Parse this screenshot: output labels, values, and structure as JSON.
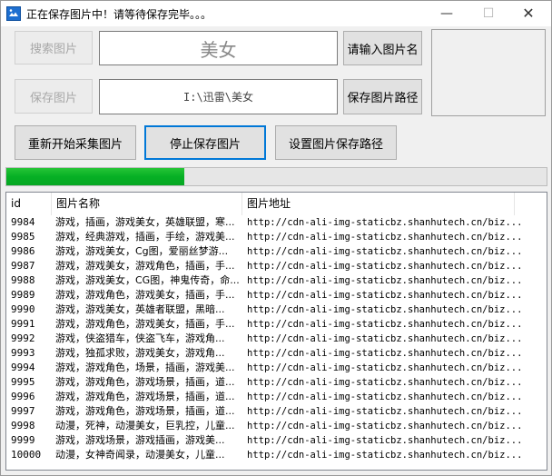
{
  "window": {
    "title": "正在保存图片中！请等待保存完毕。。。",
    "minimize": "—",
    "maximize": "☐",
    "close": "✕"
  },
  "controls": {
    "search_button": "搜索图片",
    "keyword_value": "美女",
    "enter_name_button": "请输入图片名",
    "save_button": "保存图片",
    "path_value": "I:\\迅雷\\美女",
    "save_path_button": "保存图片路径",
    "restart_button": "重新开始采集图片",
    "stop_button": "停止保存图片",
    "set_path_button": "设置图片保存路径"
  },
  "progress": {
    "percent": 33,
    "color": "#06b025"
  },
  "list": {
    "columns": [
      "id",
      "图片名称",
      "图片地址"
    ],
    "rows": [
      {
        "id": "9984",
        "name": "游戏，插画，游戏美女，英雄联盟，寒...",
        "url": "http://cdn-ali-img-staticbz.shanhutech.cn/biz..."
      },
      {
        "id": "9985",
        "name": "游戏，经典游戏，插画，手绘，游戏美...",
        "url": "http://cdn-ali-img-staticbz.shanhutech.cn/biz..."
      },
      {
        "id": "9986",
        "name": "游戏，游戏美女，Cg图，爱丽丝梦游...",
        "url": "http://cdn-ali-img-staticbz.shanhutech.cn/biz..."
      },
      {
        "id": "9987",
        "name": "游戏，游戏美女，游戏角色，插画，手...",
        "url": "http://cdn-ali-img-staticbz.shanhutech.cn/biz..."
      },
      {
        "id": "9988",
        "name": "游戏，游戏美女，CG图，神鬼传奇，命...",
        "url": "http://cdn-ali-img-staticbz.shanhutech.cn/biz..."
      },
      {
        "id": "9989",
        "name": "游戏，游戏角色，游戏美女，插画，手...",
        "url": "http://cdn-ali-img-staticbz.shanhutech.cn/biz..."
      },
      {
        "id": "9990",
        "name": "游戏，游戏美女，英雄者联盟，黑暗...",
        "url": "http://cdn-ali-img-staticbz.shanhutech.cn/biz..."
      },
      {
        "id": "9991",
        "name": "游戏，游戏角色，游戏美女，插画，手...",
        "url": "http://cdn-ali-img-staticbz.shanhutech.cn/biz..."
      },
      {
        "id": "9992",
        "name": "游戏，侠盗猎车，侠盗飞车，游戏角...",
        "url": "http://cdn-ali-img-staticbz.shanhutech.cn/biz..."
      },
      {
        "id": "9993",
        "name": "游戏，独孤求败，游戏美女，游戏角...",
        "url": "http://cdn-ali-img-staticbz.shanhutech.cn/biz..."
      },
      {
        "id": "9994",
        "name": "游戏，游戏角色，场景，插画，游戏美...",
        "url": "http://cdn-ali-img-staticbz.shanhutech.cn/biz..."
      },
      {
        "id": "9995",
        "name": "游戏，游戏角色，游戏场景，插画，道...",
        "url": "http://cdn-ali-img-staticbz.shanhutech.cn/biz..."
      },
      {
        "id": "9996",
        "name": "游戏，游戏角色，游戏场景，插画，道...",
        "url": "http://cdn-ali-img-staticbz.shanhutech.cn/biz..."
      },
      {
        "id": "9997",
        "name": "游戏，游戏角色，游戏场景，插画，道...",
        "url": "http://cdn-ali-img-staticbz.shanhutech.cn/biz..."
      },
      {
        "id": "9998",
        "name": "动漫，死神，动漫美女，巨乳控，儿童...",
        "url": "http://cdn-ali-img-staticbz.shanhutech.cn/biz..."
      },
      {
        "id": "9999",
        "name": "游戏，游戏场景，游戏插画，游戏美...",
        "url": "http://cdn-ali-img-staticbz.shanhutech.cn/biz..."
      },
      {
        "id": "10000",
        "name": "动漫，女神奇闻录，动漫美女，儿童...",
        "url": "http://cdn-ali-img-staticbz.shanhutech.cn/biz..."
      }
    ]
  }
}
